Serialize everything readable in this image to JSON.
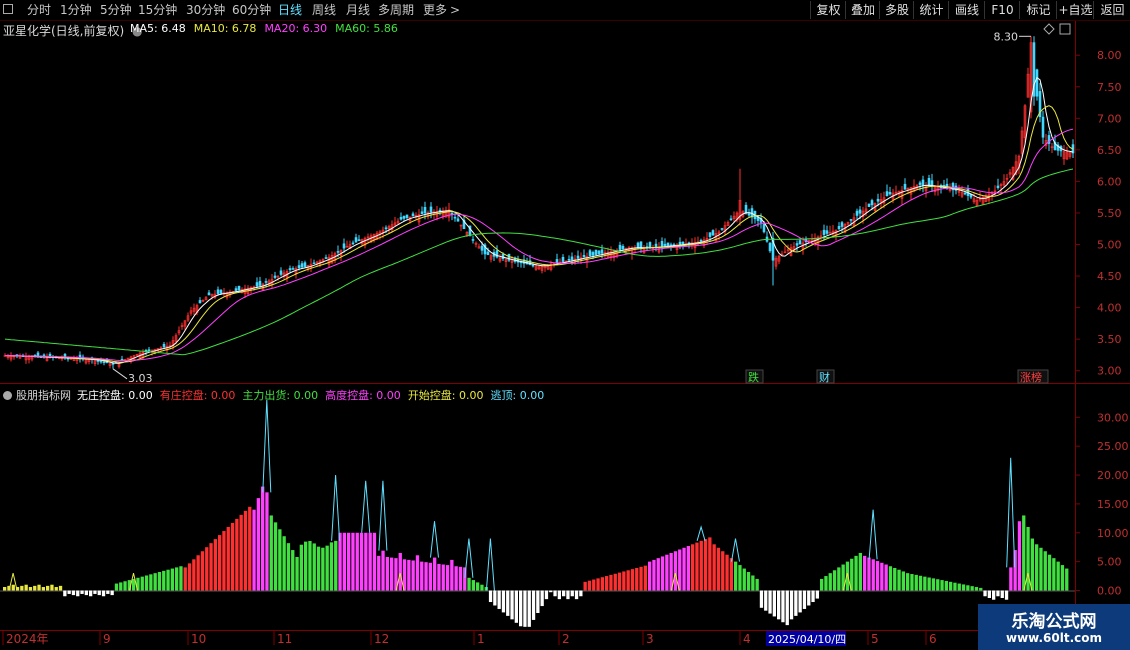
{
  "toolbar": {
    "periods": [
      "分时",
      "1分钟",
      "5分钟",
      "15分钟",
      "30分钟",
      "60分钟",
      "日线",
      "周线",
      "月线",
      "多周期",
      "更多"
    ],
    "active_period": "日线",
    "more_arrow": ">",
    "right_buttons": [
      "复权",
      "叠加",
      "多股",
      "统计",
      "画线",
      "F10",
      "标记",
      "+自选",
      "返回"
    ]
  },
  "stock": {
    "title": "亚星化学(日线,前复权)"
  },
  "ma_legend": [
    {
      "label": "MA5: 6.48",
      "color": "#ffffff"
    },
    {
      "label": "MA10: 6.78",
      "color": "#e8e840"
    },
    {
      "label": "MA20: 6.30",
      "color": "#ff40ff"
    },
    {
      "label": "MA60: 5.86",
      "color": "#40e040"
    }
  ],
  "indicator_legend": {
    "name": "股朋指标网",
    "items": [
      {
        "label": "无庄控盘: 0.00",
        "color": "#ffffff"
      },
      {
        "label": "有庄控盘: 0.00",
        "color": "#ff3030"
      },
      {
        "label": "主力出货: 0.00",
        "color": "#40e040"
      },
      {
        "label": "高度控盘: 0.00",
        "color": "#ff40ff"
      },
      {
        "label": "开始控盘: 0.00",
        "color": "#e8e840"
      },
      {
        "label": "逃顶: 0.00",
        "color": "#60e0ff"
      }
    ]
  },
  "price_axis": {
    "ticks": [
      "8.00",
      "7.50",
      "7.00",
      "6.50",
      "6.00",
      "5.50",
      "5.00",
      "4.50",
      "4.00",
      "3.50",
      "3.00"
    ],
    "min": 2.9,
    "max": 8.4
  },
  "indicator_axis": {
    "ticks": [
      "30.00",
      "25.00",
      "20.00",
      "15.00",
      "10.00",
      "5.00",
      "0.00"
    ],
    "min": -6.5,
    "max": 33
  },
  "annotations": {
    "high": "8.30",
    "low": "3.03",
    "tags": [
      {
        "text": "跌",
        "color": "#40e040"
      },
      {
        "text": "财",
        "color": "#60e0ff"
      },
      {
        "text": "涨榜",
        "color": "#ff4040"
      }
    ]
  },
  "date_axis": {
    "labels": [
      "2024年",
      "9",
      "10",
      "11",
      "12",
      "1",
      "2",
      "3",
      "4",
      "5",
      "6"
    ],
    "cursor_date": "2025/04/10/四"
  },
  "watermark": {
    "title": "乐淘公式网",
    "url": "www.60lt.com"
  },
  "chart_data": {
    "type": "candlestick",
    "title": "亚星化学(日线,前复权)",
    "price_range": [
      2.9,
      8.4
    ],
    "high": 8.3,
    "low": 3.03,
    "moving_averages": {
      "MA5": 6.48,
      "MA10": 6.78,
      "MA20": 6.3,
      "MA60": 5.86
    },
    "close_path": [
      [
        0,
        3.24
      ],
      [
        10,
        3.22
      ],
      [
        20,
        3.2
      ],
      [
        30,
        3.17
      ],
      [
        36,
        3.1
      ],
      [
        45,
        3.28
      ],
      [
        55,
        3.4
      ],
      [
        62,
        3.95
      ],
      [
        68,
        4.2
      ],
      [
        75,
        4.25
      ],
      [
        85,
        4.35
      ],
      [
        95,
        4.6
      ],
      [
        100,
        4.65
      ],
      [
        108,
        4.8
      ],
      [
        115,
        5.0
      ],
      [
        125,
        5.2
      ],
      [
        132,
        5.4
      ],
      [
        140,
        5.5
      ],
      [
        148,
        5.55
      ],
      [
        153,
        5.25
      ],
      [
        160,
        4.85
      ],
      [
        168,
        4.75
      ],
      [
        178,
        4.65
      ],
      [
        188,
        4.75
      ],
      [
        198,
        4.85
      ],
      [
        208,
        4.95
      ],
      [
        215,
        4.95
      ],
      [
        225,
        5.0
      ],
      [
        232,
        5.05
      ],
      [
        238,
        5.2
      ],
      [
        245,
        5.55
      ],
      [
        252,
        5.35
      ],
      [
        256,
        4.75
      ],
      [
        262,
        4.95
      ],
      [
        270,
        5.1
      ],
      [
        278,
        5.25
      ],
      [
        288,
        5.6
      ],
      [
        295,
        5.8
      ],
      [
        305,
        5.95
      ],
      [
        312,
        5.9
      ],
      [
        318,
        5.85
      ],
      [
        324,
        5.7
      ],
      [
        330,
        5.85
      ],
      [
        334,
        6.05
      ],
      [
        338,
        6.4
      ],
      [
        340,
        7.2
      ],
      [
        342,
        8.2
      ],
      [
        344,
        7.35
      ],
      [
        346,
        6.7
      ],
      [
        350,
        6.5
      ],
      [
        356,
        6.45
      ]
    ],
    "indicator": {
      "type": "bar",
      "series": [
        "无庄控盘",
        "有庄控盘",
        "主力出货",
        "高度控盘",
        "开始控盘",
        "逃顶"
      ],
      "range": [
        -6.5,
        33
      ]
    }
  }
}
